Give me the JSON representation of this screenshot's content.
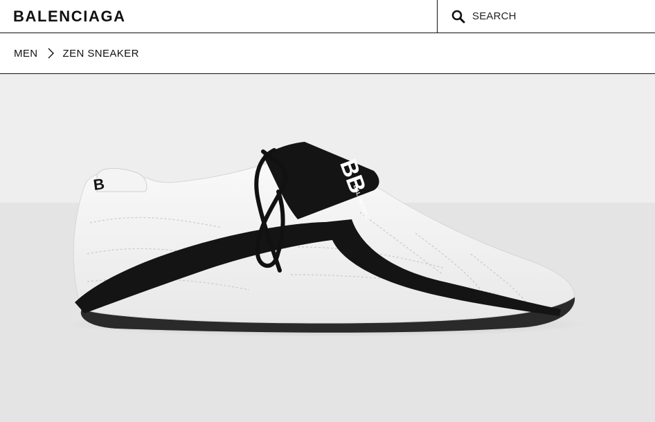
{
  "header": {
    "brand": "BALENCIAGA",
    "search_label": "SEARCH",
    "search_icon": "search-icon"
  },
  "breadcrumb": {
    "items": [
      {
        "label": "MEN"
      },
      {
        "label": "ZEN SNEAKER"
      }
    ],
    "separator_icon": "chevron-right-icon"
  },
  "product_image": {
    "alt": "Zen Sneaker",
    "logo_mark": "BB",
    "logo_text": "BALENCIAGA",
    "colors": {
      "upper": "#f7f7f7",
      "accent": "#141414",
      "sole": "#2a2a2a"
    }
  }
}
